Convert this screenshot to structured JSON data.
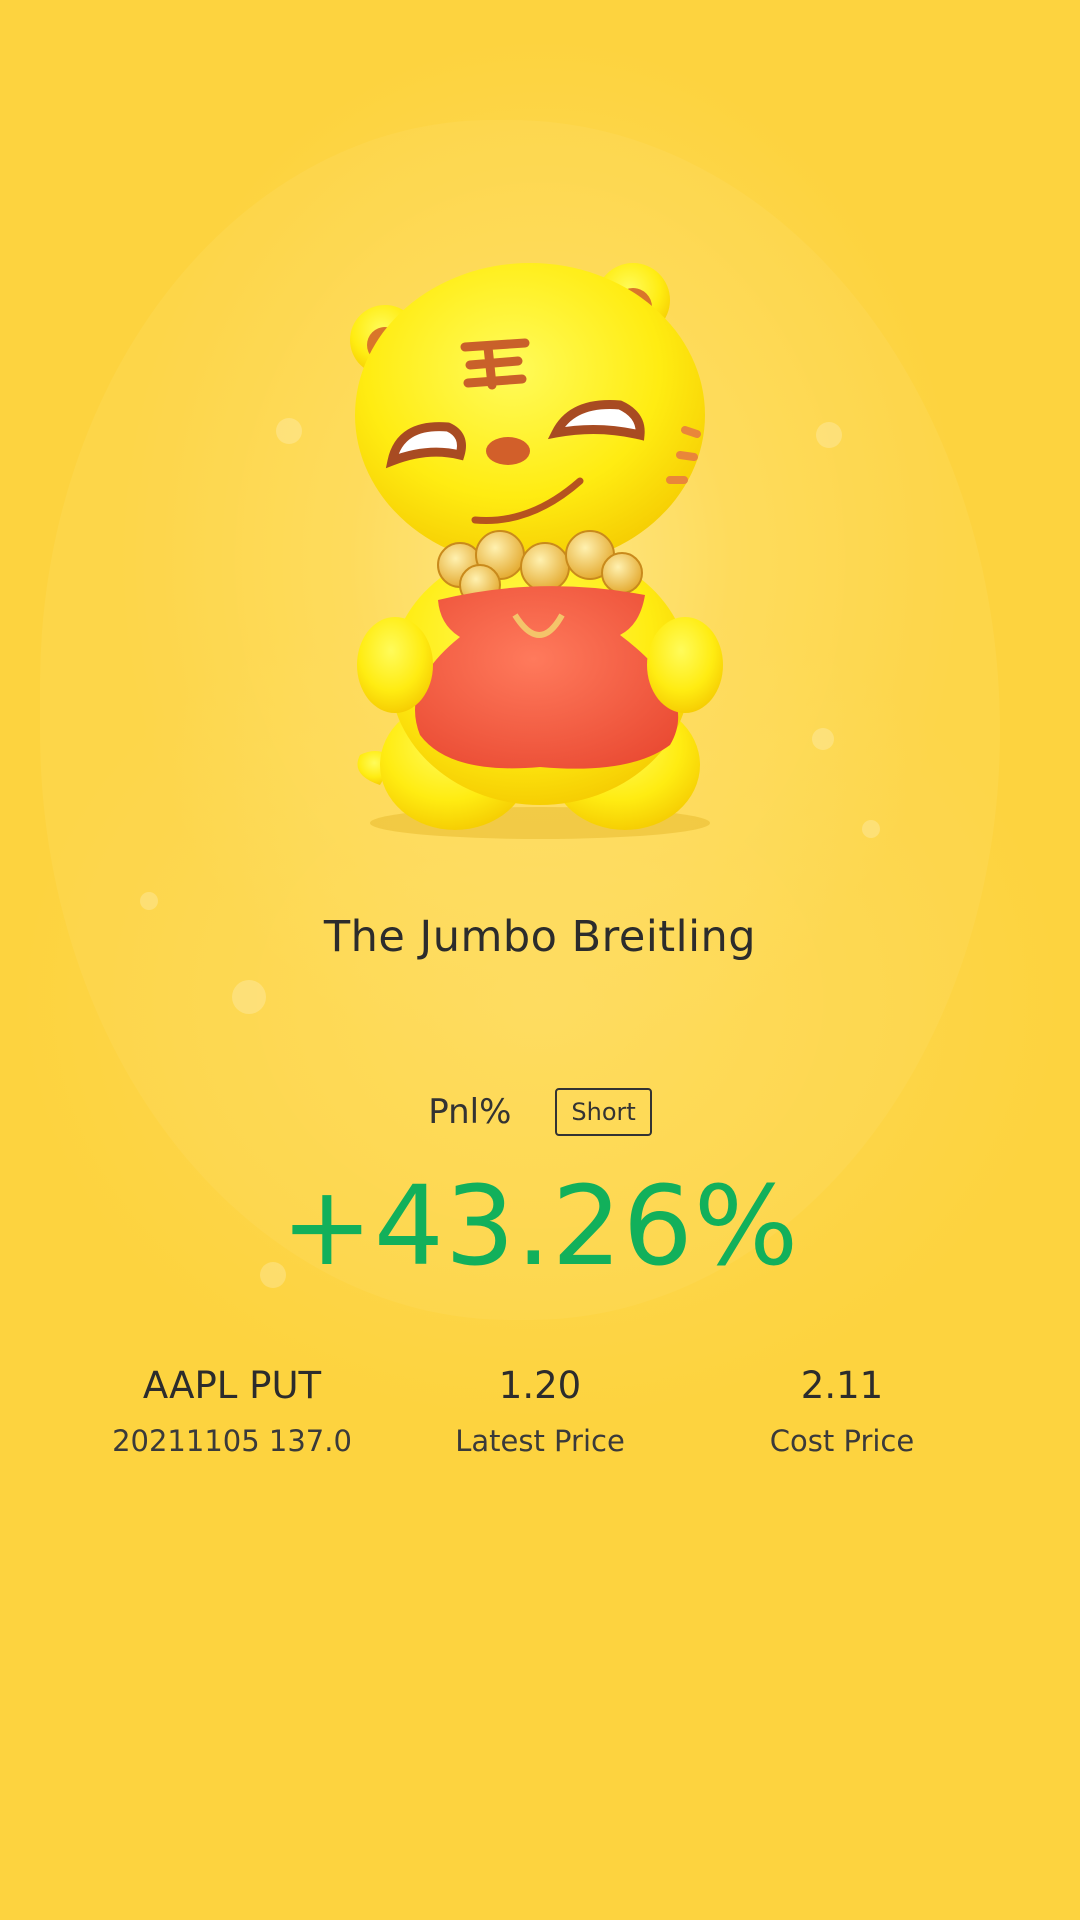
{
  "card": {
    "title": "The Jumbo Breitling",
    "pnl_label": "Pnl%",
    "direction": "Short",
    "pnl_value": "+43.26%",
    "colors": {
      "background": "#fdd33f",
      "profit": "#12b05b",
      "text": "#2c2c2c"
    },
    "mascot_icon": "tiger-with-money-bag-icon"
  },
  "stats": [
    {
      "value": "AAPL PUT",
      "label": "20211105 137.0"
    },
    {
      "value": "1.20",
      "label": "Latest Price"
    },
    {
      "value": "2.11",
      "label": "Cost Price"
    }
  ]
}
